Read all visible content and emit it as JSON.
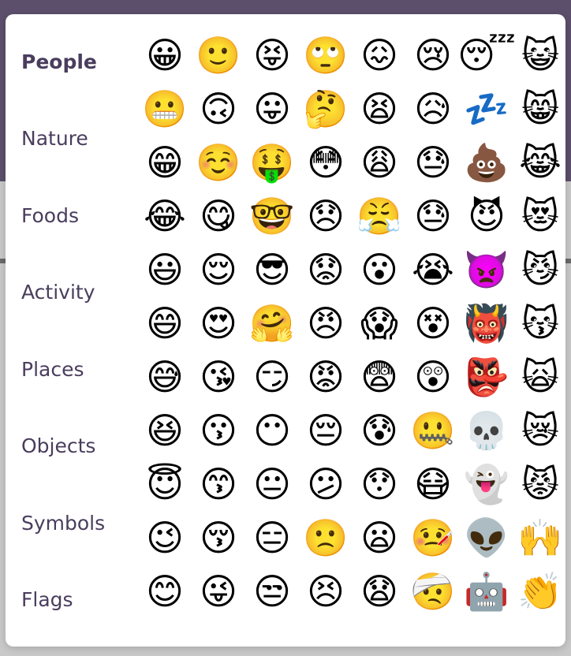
{
  "picker": {
    "categories": [
      {
        "label": "People",
        "active": true
      },
      {
        "label": "Nature",
        "active": false
      },
      {
        "label": "Foods",
        "active": false
      },
      {
        "label": "Activity",
        "active": false
      },
      {
        "label": "Places",
        "active": false
      },
      {
        "label": "Objects",
        "active": false
      },
      {
        "label": "Symbols",
        "active": false
      },
      {
        "label": "Flags",
        "active": false
      }
    ],
    "emoji_rows": [
      [
        "😀",
        "🙂",
        "😝",
        "🙄",
        "😖",
        "😢",
        "😴",
        "😺"
      ],
      [
        "😬",
        "🙃",
        "😛",
        "🤔",
        "😫",
        "😥",
        "💤",
        "😸"
      ],
      [
        "😁",
        "☺️",
        "🤑",
        "😳",
        "😩",
        "😓",
        "💩",
        "😹"
      ],
      [
        "😂",
        "😋",
        "🤓",
        "😞",
        "😤",
        "😓",
        "😈",
        "😻"
      ],
      [
        "😃",
        "😌",
        "😎",
        "😟",
        "😮",
        "😭",
        "👿",
        "😼"
      ],
      [
        "😄",
        "😍",
        "🤗",
        "😠",
        "😱",
        "😵",
        "👹",
        "😽"
      ],
      [
        "😅",
        "😘",
        "😏",
        "😡",
        "😨",
        "😲",
        "👺",
        "🙀"
      ],
      [
        "😆",
        "😗",
        "😶",
        "😔",
        "😰",
        "🤐",
        "💀",
        "😿"
      ],
      [
        "😇",
        "😙",
        "😐",
        "😕",
        "😯",
        "😷",
        "👻",
        "😾"
      ],
      [
        "😉",
        "😚",
        "😑",
        "🙁",
        "😦",
        "🤒",
        "👽",
        "🙌"
      ],
      [
        "😊",
        "😜",
        "😒",
        "😣",
        "😧",
        "🤕",
        "🤖",
        "👏"
      ]
    ]
  }
}
